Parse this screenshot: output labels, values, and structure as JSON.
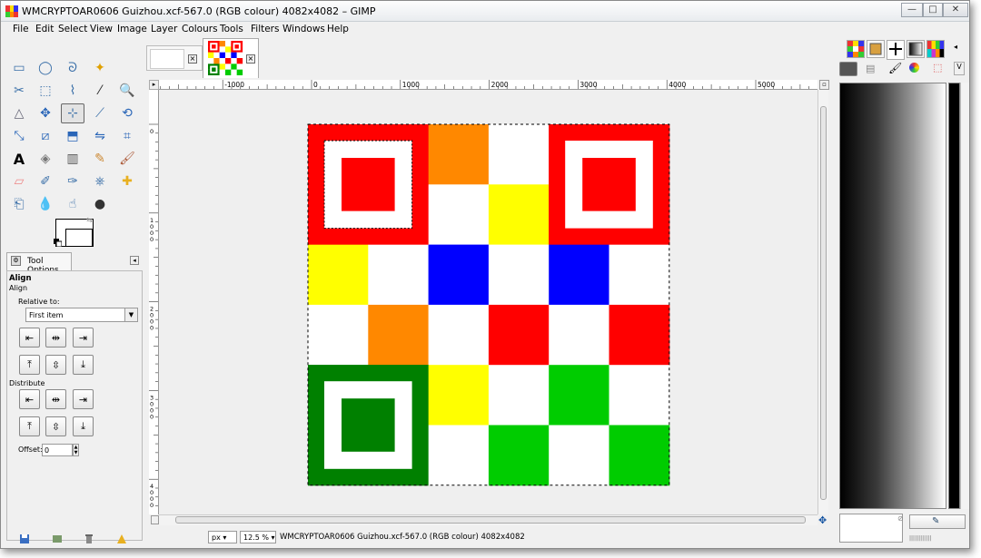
{
  "window": {
    "title": "WMCRYPTOAR0606 Guizhou.xcf-567.0 (RGB colour) 4082x4082 – GIMP",
    "minimize": "—",
    "maximize": "□",
    "close": "✕"
  },
  "menubar": {
    "items": [
      "File",
      "Edit",
      "Select",
      "View",
      "Image",
      "Layer",
      "Colours",
      "Tools",
      "Filters",
      "Windows",
      "Help"
    ]
  },
  "toolbox": {
    "rows": [
      [
        "rect-select-icon",
        "ellipse-select-icon",
        "lasso-icon",
        "fuzzy-select-icon"
      ],
      [
        "scissors-icon",
        "color-select-icon",
        "paths-icon",
        "color-picker-icon",
        "zoom-icon"
      ],
      [
        "measure-icon",
        "move-icon",
        "align-icon",
        "crop-icon",
        "rotate-icon"
      ],
      [
        "scale-icon",
        "shear-icon",
        "perspective-icon",
        "flip-icon",
        "cage-icon"
      ],
      [
        "text-icon",
        "bucket-fill-icon",
        "blend-icon",
        "pencil-icon",
        "paintbrush-icon"
      ],
      [
        "eraser-icon",
        "airbrush-icon",
        "ink-icon",
        "clone-icon",
        "heal-icon"
      ],
      [
        "perspective-clone-icon",
        "blur-icon",
        "smudge-icon",
        "dodge-burn-icon"
      ]
    ],
    "active_tool": "align-icon"
  },
  "tool_options": {
    "tab_label": "Tool Options",
    "heading": "Align",
    "subheading": "Align",
    "relative_label": "Relative to:",
    "relative_value": "First item",
    "distribute_label": "Distribute",
    "offset_label": "Offset:",
    "offset_value": "0"
  },
  "rulers": {
    "horizontal_labels": [
      "-1000",
      "0",
      "1000",
      "2000",
      "3000",
      "4000",
      "5000"
    ],
    "vertical_labels": [
      "0",
      "1000",
      "2000",
      "3000",
      "4000"
    ]
  },
  "image": {
    "grid": [
      [
        "#ff0000",
        "#ff0000",
        "#ff8800",
        "#ffffff",
        "#ff0000",
        "#ff0000"
      ],
      [
        "#ff0000",
        "#ff0000",
        "#ffffff",
        "#ffff00",
        "#ff0000",
        "#ff0000"
      ],
      [
        "#ffff00",
        "#ffffff",
        "#0000ff",
        "#ffffff",
        "#0000ff",
        "#ffffff"
      ],
      [
        "#ffffff",
        "#ff8800",
        "#ffffff",
        "#ff0000",
        "#ffffff",
        "#ff0000"
      ],
      [
        "#008000",
        "#008000",
        "#ffff00",
        "#ffffff",
        "#00cc00",
        "#ffffff"
      ],
      [
        "#008000",
        "#008000",
        "#ffffff",
        "#00cc00",
        "#ffffff",
        "#00cc00"
      ]
    ],
    "finders": [
      {
        "corner": "top-left",
        "color": "#ff0000"
      },
      {
        "corner": "top-right",
        "color": "#ff0000"
      },
      {
        "corner": "bottom-left",
        "color": "#008000"
      }
    ]
  },
  "statusbar": {
    "unit": "px",
    "zoom": "12.5 %",
    "text": "WMCRYPTOAR0606 Guizhou.xcf-567.0 (RGB colour) 4082x4082"
  }
}
